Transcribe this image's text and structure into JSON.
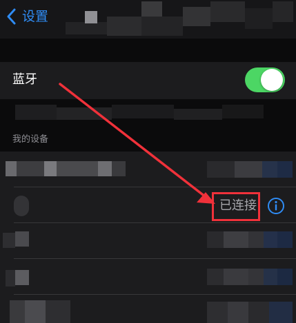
{
  "nav": {
    "back_label": "设置"
  },
  "bluetooth": {
    "label": "蓝牙",
    "toggle_on": true
  },
  "section": {
    "my_devices_header": "我的设备"
  },
  "connected_device": {
    "status": "已连接"
  },
  "colors": {
    "accent": "#2f8cf5",
    "toggle_on": "#4cd664",
    "annotation_red": "#f0313a",
    "cell_background": "#1c1c1e"
  },
  "icons": {
    "back": "chevron-left-icon",
    "info": "info-circle-icon"
  }
}
